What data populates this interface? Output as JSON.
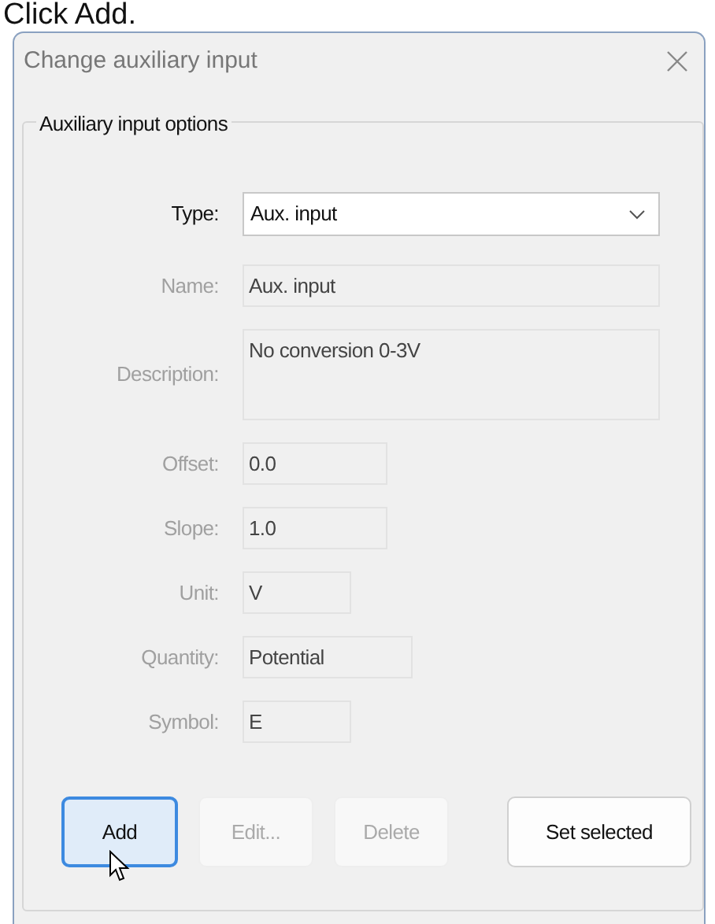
{
  "caption": "Click Add.",
  "window": {
    "title": "Change auxiliary input"
  },
  "group": {
    "legend": "Auxiliary input options"
  },
  "type_select": {
    "label": "Type:",
    "value": "Aux. input",
    "disabled": false
  },
  "fields": [
    {
      "label": "Name:",
      "value": "Aux. input",
      "disabled": true,
      "kind": "line"
    },
    {
      "label": "Description:",
      "value": "No conversion 0-3V",
      "disabled": true,
      "kind": "area"
    },
    {
      "label": "Offset:",
      "value": "0.0",
      "disabled": true,
      "kind": "line"
    },
    {
      "label": "Slope:",
      "value": "1.0",
      "disabled": true,
      "kind": "line"
    },
    {
      "label": "Unit:",
      "value": "V",
      "disabled": true,
      "kind": "line"
    },
    {
      "label": "Quantity:",
      "value": "Potential",
      "disabled": true,
      "kind": "line"
    },
    {
      "label": "Symbol:",
      "value": "E",
      "disabled": true,
      "kind": "line"
    }
  ],
  "buttons": [
    {
      "label": "Add",
      "disabled": false,
      "focused": true
    },
    {
      "label": "Edit...",
      "disabled": true,
      "focused": false
    },
    {
      "label": "Delete",
      "disabled": true,
      "focused": false
    },
    {
      "label": "Set selected",
      "disabled": false,
      "focused": false
    }
  ]
}
